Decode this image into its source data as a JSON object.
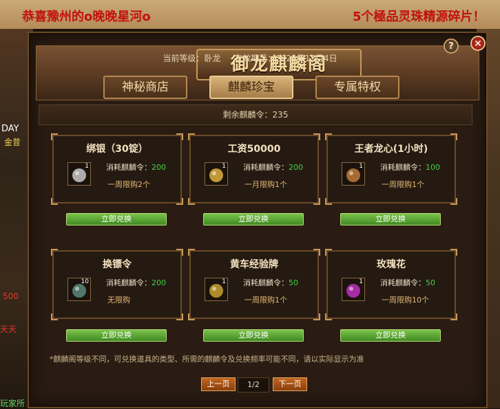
{
  "background": {
    "marquee_left": "恭喜豫州的o晚晚星河o",
    "marquee_right": "5个極品灵珠精源碎片！",
    "side_texts": [
      "DAY",
      "金昔",
      "500",
      "天天",
      "玩家所"
    ]
  },
  "panel": {
    "title": "御龙麒麟阁",
    "level_label": "当前等级：卧龙",
    "expiry_label": "有效期至：2025年12月4日",
    "help_label": "?",
    "close_label": "✕"
  },
  "tabs": [
    {
      "label": "神秘商店",
      "active": false
    },
    {
      "label": "麒麟珍宝",
      "active": true
    },
    {
      "label": "专属特权",
      "active": false
    }
  ],
  "remaining": "剩余麒麟令：235",
  "items": [
    {
      "name": "绑银（30锭）",
      "count": "1",
      "cost_label": "消耗麒麟令：",
      "cost": "200",
      "limit": "一周限购2个",
      "icon": "silver-ingot-icon",
      "icon_color": "#c8c8c8",
      "button": "立即兑换"
    },
    {
      "name": "工资50000",
      "count": "1",
      "cost_label": "消耗麒麟令：",
      "cost": "200",
      "limit": "一月限购1个",
      "icon": "gold-coin-icon",
      "icon_color": "#e0b040",
      "button": "立即兑换"
    },
    {
      "name": "王者龙心(1小时)",
      "count": "1",
      "cost_label": "消耗麒麟令：",
      "cost": "100",
      "limit": "一周限购1个",
      "icon": "dragon-heart-icon",
      "icon_color": "#c07a3a",
      "button": "立即兑换"
    },
    {
      "name": "换镖令",
      "count": "10",
      "cost_label": "消耗麒麟令：",
      "cost": "200",
      "limit": "无限购",
      "icon": "escort-token-icon",
      "icon_color": "#5a8a7a",
      "button": "立即兑换"
    },
    {
      "name": "黄车经验牌",
      "count": "1",
      "cost_label": "消耗麒麟令：",
      "cost": "50",
      "limit": "一周限购1个",
      "icon": "yellow-cart-icon",
      "icon_color": "#c8a030",
      "button": "立即兑换"
    },
    {
      "name": "玫瑰花",
      "count": "1",
      "cost_label": "消耗麒麟令：",
      "cost": "50",
      "limit": "一周限购10个",
      "icon": "rose-icon",
      "icon_color": "#c030c0",
      "button": "立即兑换"
    }
  ],
  "note": "*麒麟阁等级不同，可兑换道具的类型、所需的麒麟令及兑换频率可能不同，请以实际显示为准",
  "pager": {
    "prev": "上一页",
    "page": "1/2",
    "next": "下一页"
  }
}
